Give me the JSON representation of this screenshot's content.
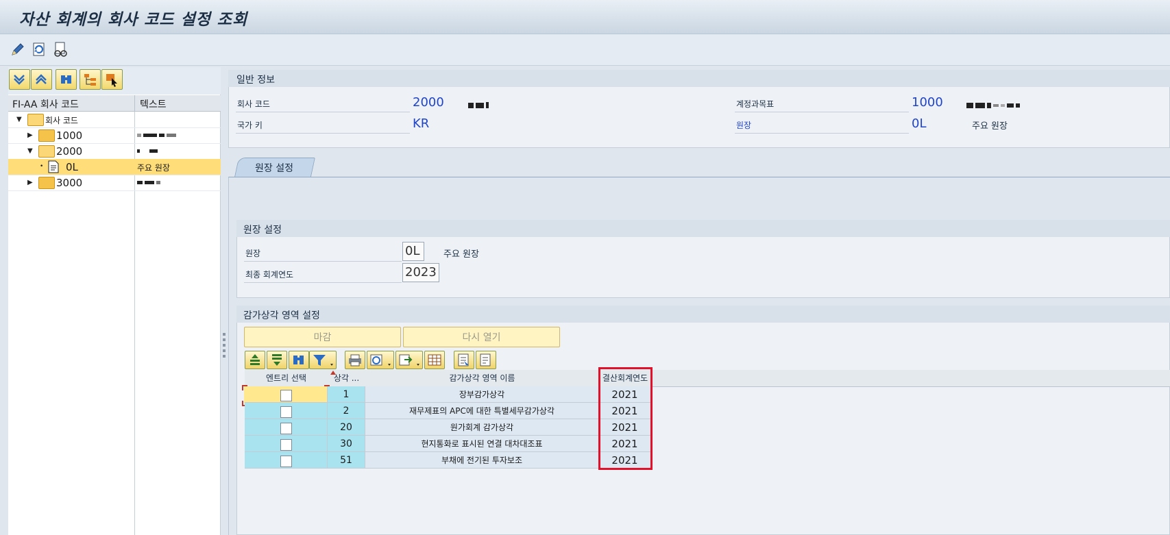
{
  "window_title": "자산 회계의 회사 코드 설정 조회",
  "toolbar": {
    "icons": [
      "pencil-icon",
      "refresh-icon",
      "glasses-icon"
    ]
  },
  "tree": {
    "tools": [
      "expand-all-icon",
      "collapse-all-icon",
      "find-icon",
      "tree-structure-icon",
      "select-icon"
    ],
    "col1": "FI-AA 회사 코드",
    "col2": "텍스트",
    "rows": [
      {
        "label": "회사 코드",
        "text": ""
      },
      {
        "label": "1000",
        "text": ""
      },
      {
        "label": "2000",
        "text": ""
      },
      {
        "label": "0L",
        "text": "주요 원장"
      },
      {
        "label": "3000",
        "text": ""
      }
    ]
  },
  "general": {
    "title": "일반 정보",
    "company_code_label": "회사 코드",
    "company_code": "2000",
    "country_label": "국가 키",
    "country": "KR",
    "coa_label": "계정과목표",
    "coa": "1000",
    "ledger_label": "원장",
    "ledger": "0L",
    "ledger_text": "주요 원장"
  },
  "tab": {
    "label": "원장 설정"
  },
  "ledger_settings": {
    "title": "원장 설정",
    "ledger_label": "원장",
    "ledger_value": "0L",
    "ledger_text": "주요 원장",
    "last_year_label": "최종 회계연도",
    "last_year_value": "2023"
  },
  "depr_areas": {
    "title": "감가상각 영역 설정",
    "close_button": "마감",
    "reopen_button": "다시 열기",
    "headers": [
      "엔트리 선택",
      "상각 ...",
      "감가상각 영역 이름",
      "결산회계연도"
    ],
    "rows": [
      {
        "area": "1",
        "name": "장부감가상각",
        "year": "2021"
      },
      {
        "area": "2",
        "name": "재무제표의 APC에 대한 특별세무감가상각",
        "year": "2021"
      },
      {
        "area": "20",
        "name": "원가회계 감가상각",
        "year": "2021"
      },
      {
        "area": "30",
        "name": "현지통화로 표시된 연결 대차대조표",
        "year": "2021"
      },
      {
        "area": "51",
        "name": "부채에 전기된 투자보조",
        "year": "2021"
      }
    ]
  }
}
